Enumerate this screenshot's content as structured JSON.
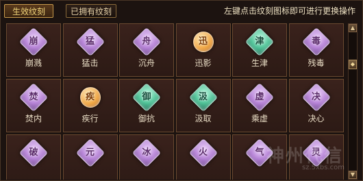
{
  "tabs": {
    "active_label": "生效纹刻",
    "owned_label": "已拥有纹刻"
  },
  "hint": "左键点击纹刻图标即可进行更换操作",
  "grid": {
    "rows": [
      [
        {
          "label": "崩溅",
          "glyph": "崩",
          "color": "purple"
        },
        {
          "label": "猛击",
          "glyph": "猛",
          "color": "purple"
        },
        {
          "label": "沉舟",
          "glyph": "舟",
          "color": "purple"
        },
        {
          "label": "迅影",
          "glyph": "迅",
          "color": "orange"
        },
        {
          "label": "生津",
          "glyph": "津",
          "color": "green"
        },
        {
          "label": "残毒",
          "glyph": "毒",
          "color": "purple"
        }
      ],
      [
        {
          "label": "焚内",
          "glyph": "焚",
          "color": "purple"
        },
        {
          "label": "疾行",
          "glyph": "疾",
          "color": "orange"
        },
        {
          "label": "御抗",
          "glyph": "御",
          "color": "green"
        },
        {
          "label": "汲取",
          "glyph": "汲",
          "color": "green"
        },
        {
          "label": "乘虚",
          "glyph": "虚",
          "color": "purple"
        },
        {
          "label": "决心",
          "glyph": "决",
          "color": "purple"
        }
      ],
      [
        {
          "label": "",
          "glyph": "破",
          "color": "purple"
        },
        {
          "label": "",
          "glyph": "元",
          "color": "purple"
        },
        {
          "label": "",
          "glyph": "冰",
          "color": "purple"
        },
        {
          "label": "",
          "glyph": "火",
          "color": "purple"
        },
        {
          "label": "",
          "glyph": "气",
          "color": "purple"
        },
        {
          "label": "",
          "glyph": "灵",
          "color": "purple"
        }
      ]
    ]
  },
  "scrollbar": {
    "up_icon": "up-arrow-icon",
    "down_icon": "down-arrow-icon",
    "thumb_icon": "diamond-icon"
  },
  "watermark": {
    "text": "神州代信",
    "url": "sz.5xbs.com"
  }
}
